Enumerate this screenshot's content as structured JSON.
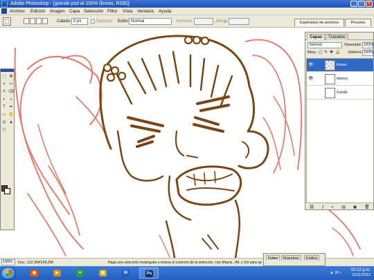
{
  "window": {
    "title": "Adobe Photoshop - [grande.psd al 100% (lineas, RGB)]",
    "logo_glyph": "Ps",
    "buttons": {
      "minimize": "_",
      "maximize": "□",
      "close": "×"
    }
  },
  "menu": {
    "items": [
      "Archivo",
      "Edición",
      "Imagen",
      "Capa",
      "Selección",
      "Filtro",
      "Vista",
      "Ventana",
      "Ayuda"
    ]
  },
  "options": {
    "tool_glyph": "⬚",
    "calado_label": "Calado:",
    "calado_value": "0 px",
    "suavizar_label": "Suavizar",
    "estilo_label": "Estilo:",
    "estilo_value": "Normal",
    "anchura_label": "Anchura:",
    "altura_label": "Altura:",
    "swap_glyph": "⇄",
    "tabs": [
      "Explorador de archivos",
      "Pinceles"
    ]
  },
  "toolbox": {
    "tool_glyphs": [
      "⬚",
      "✥",
      "⌖",
      "✂",
      "✎",
      "⌫",
      "◐",
      "⌕",
      "T",
      "✒",
      "▭",
      "✋",
      "◎",
      "▲",
      "◻"
    ],
    "fg_color": "#6b3b0e",
    "bg_color": "#ffffff"
  },
  "layers_panel": {
    "tabs": [
      "Capas",
      "Trazados"
    ],
    "blend_mode": "Normal",
    "opacity_label": "Opacidad:",
    "opacity_value": "100%",
    "lock_label": "Bloq.:",
    "fill_label": "Relleno:",
    "fill_value": "100%",
    "lock_icons": [
      "▢",
      "✎",
      "✥",
      "🔒"
    ],
    "eye_glyph": "👁",
    "layers": [
      {
        "name": "lineas",
        "selected": true,
        "visible": true
      },
      {
        "name": "blanco",
        "selected": false,
        "visible": true
      },
      {
        "name": "Fondo",
        "selected": false,
        "visible": false
      }
    ],
    "footer_glyphs": [
      "⛓",
      "ƒ",
      "◐",
      "▤",
      "▣",
      "🗑"
    ]
  },
  "status": {
    "zoom": "100%",
    "doc": "Doc: 112,3M/154,2M",
    "hint": "Haga una selección rectangular o mueva el contorno de la selección. Use Mayús., Alt. y Ctrl para opciones adicionales."
  },
  "color_panel": {
    "tabs": [
      "Color",
      "Muestras",
      "Estilos"
    ]
  },
  "taskbar": {
    "apps": [
      {
        "name": "firefox",
        "glyph": "◉",
        "color": "#e66000"
      },
      {
        "name": "media-player",
        "glyph": "▶",
        "color": "#e08a00"
      },
      {
        "name": "messenger",
        "glyph": "✦",
        "color": "#2a9d3a"
      },
      {
        "name": "explorer",
        "glyph": "▤",
        "color": "#d9a400"
      },
      {
        "name": "word",
        "glyph": "W",
        "color": "#1f5fbf"
      },
      {
        "name": "photoshop",
        "glyph": "Ps",
        "color": "#0b2f6b"
      }
    ],
    "time": "02:12 p.m.",
    "date": "12/11/2012",
    "tray_icons": "▲ ✉ ♪"
  },
  "colors": {
    "line_brown": "#7a4514",
    "sketch_red": "#e07e70",
    "selection_blue": "#3169c6"
  }
}
